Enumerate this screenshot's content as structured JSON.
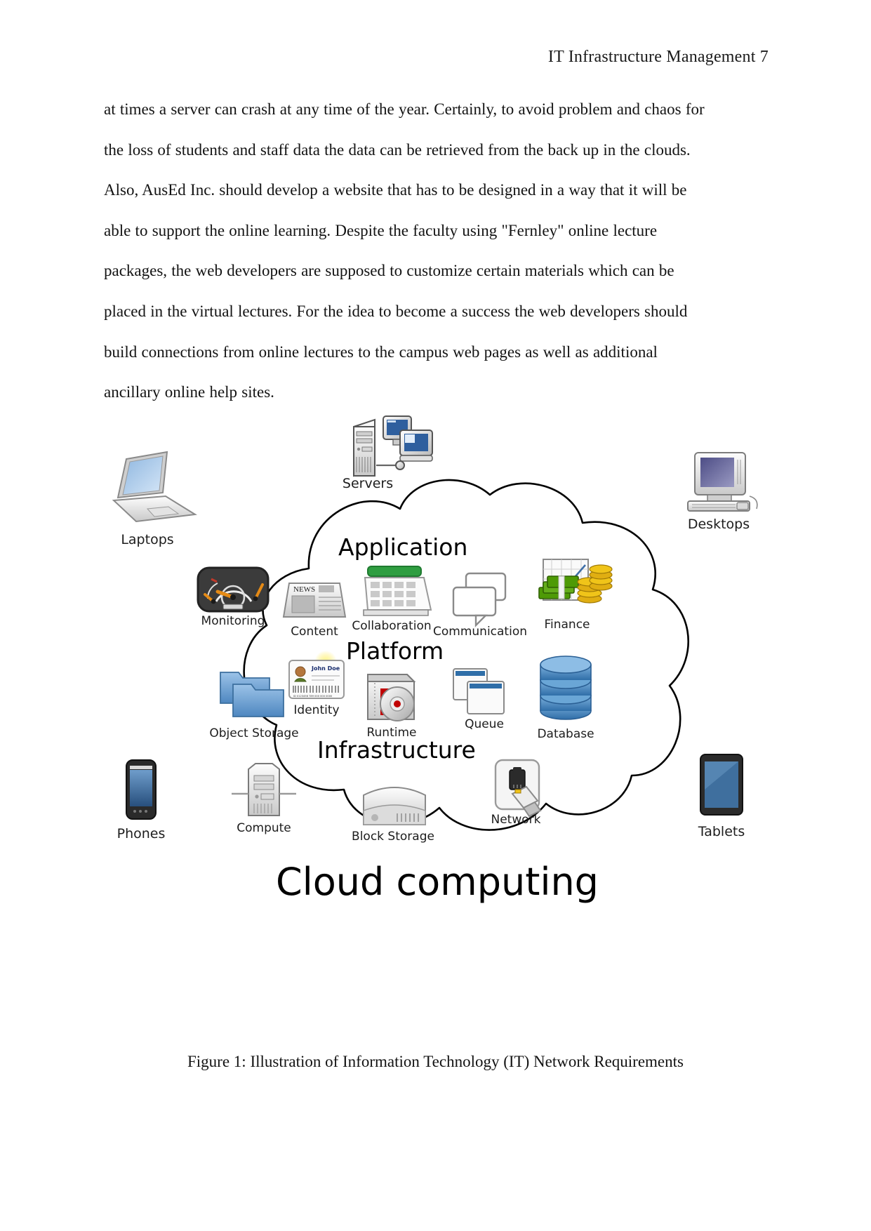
{
  "document": {
    "header": "IT Infrastructure Management 7",
    "paragraph_lines": [
      "at times a server can crash at any time of the year. Certainly, to avoid problem and chaos for",
      "the loss of students and staff data the data can be retrieved from the back up in the clouds.",
      "Also, AusEd Inc. should develop a website that has to be designed in a way that it will be",
      "able to support the online learning. Despite the faculty using \"Fernley\" online lecture",
      "packages, the web developers are supposed to customize certain materials which can be",
      "placed in the virtual lectures. For the idea to become a success the web developers should",
      "build connections from online lectures to the campus web pages as well as additional",
      "ancillary online help sites."
    ],
    "figure_caption": "Figure 1: Illustration of Information Technology (IT) Network Requirements"
  },
  "diagram": {
    "title": "Cloud computing",
    "layers": {
      "application": "Application",
      "platform": "Platform",
      "infrastructure": "Infrastructure"
    },
    "external_devices": [
      {
        "label": "Servers",
        "icon": "servers-icon"
      },
      {
        "label": "Laptops",
        "icon": "laptop-icon"
      },
      {
        "label": "Desktops",
        "icon": "desktop-icon"
      },
      {
        "label": "Phones",
        "icon": "phone-icon"
      },
      {
        "label": "Tablets",
        "icon": "tablet-icon"
      }
    ],
    "application_services": [
      {
        "label": "Monitoring",
        "icon": "gauge-icon"
      },
      {
        "label": "Content",
        "icon": "newspaper-icon"
      },
      {
        "label": "Collaboration",
        "icon": "calendar-icon"
      },
      {
        "label": "Communication",
        "icon": "speech-bubbles-icon"
      },
      {
        "label": "Finance",
        "icon": "money-chart-icon"
      }
    ],
    "platform_services": [
      {
        "label": "Object Storage",
        "icon": "folders-icon"
      },
      {
        "label": "Identity",
        "icon": "id-badge-icon"
      },
      {
        "label": "Runtime",
        "icon": "disc-box-icon"
      },
      {
        "label": "Queue",
        "icon": "windows-stack-icon"
      },
      {
        "label": "Database",
        "icon": "database-cylinder-icon"
      }
    ],
    "infrastructure_services": [
      {
        "label": "Compute",
        "icon": "server-tower-icon"
      },
      {
        "label": "Block Storage",
        "icon": "hard-drive-icon"
      },
      {
        "label": "Network",
        "icon": "network-jack-icon"
      }
    ],
    "identity_card": {
      "name": "John Doe",
      "barcode_caption": "ID 0123456 789 000 000 0000"
    },
    "content_icon_text": "NEWS",
    "colors": {
      "cloud_outline": "#000000",
      "folder_blue": "#5b9bd5",
      "database_blue": "#3f7fbf",
      "calendar_green": "#2f9e41",
      "money_green": "#4e9a06",
      "coin_gold": "#f0c419",
      "laptop_screen": "#7fa8d8",
      "desktop_screen": "#56568f",
      "phone_screen": "#3a6ea5",
      "tablet_screen": "#2f5f94",
      "runtime_red": "#c00000",
      "gauge_dark": "#3b3b3b",
      "needle_orange": "#e58a15",
      "badge_glow": "#ffe84d"
    }
  }
}
